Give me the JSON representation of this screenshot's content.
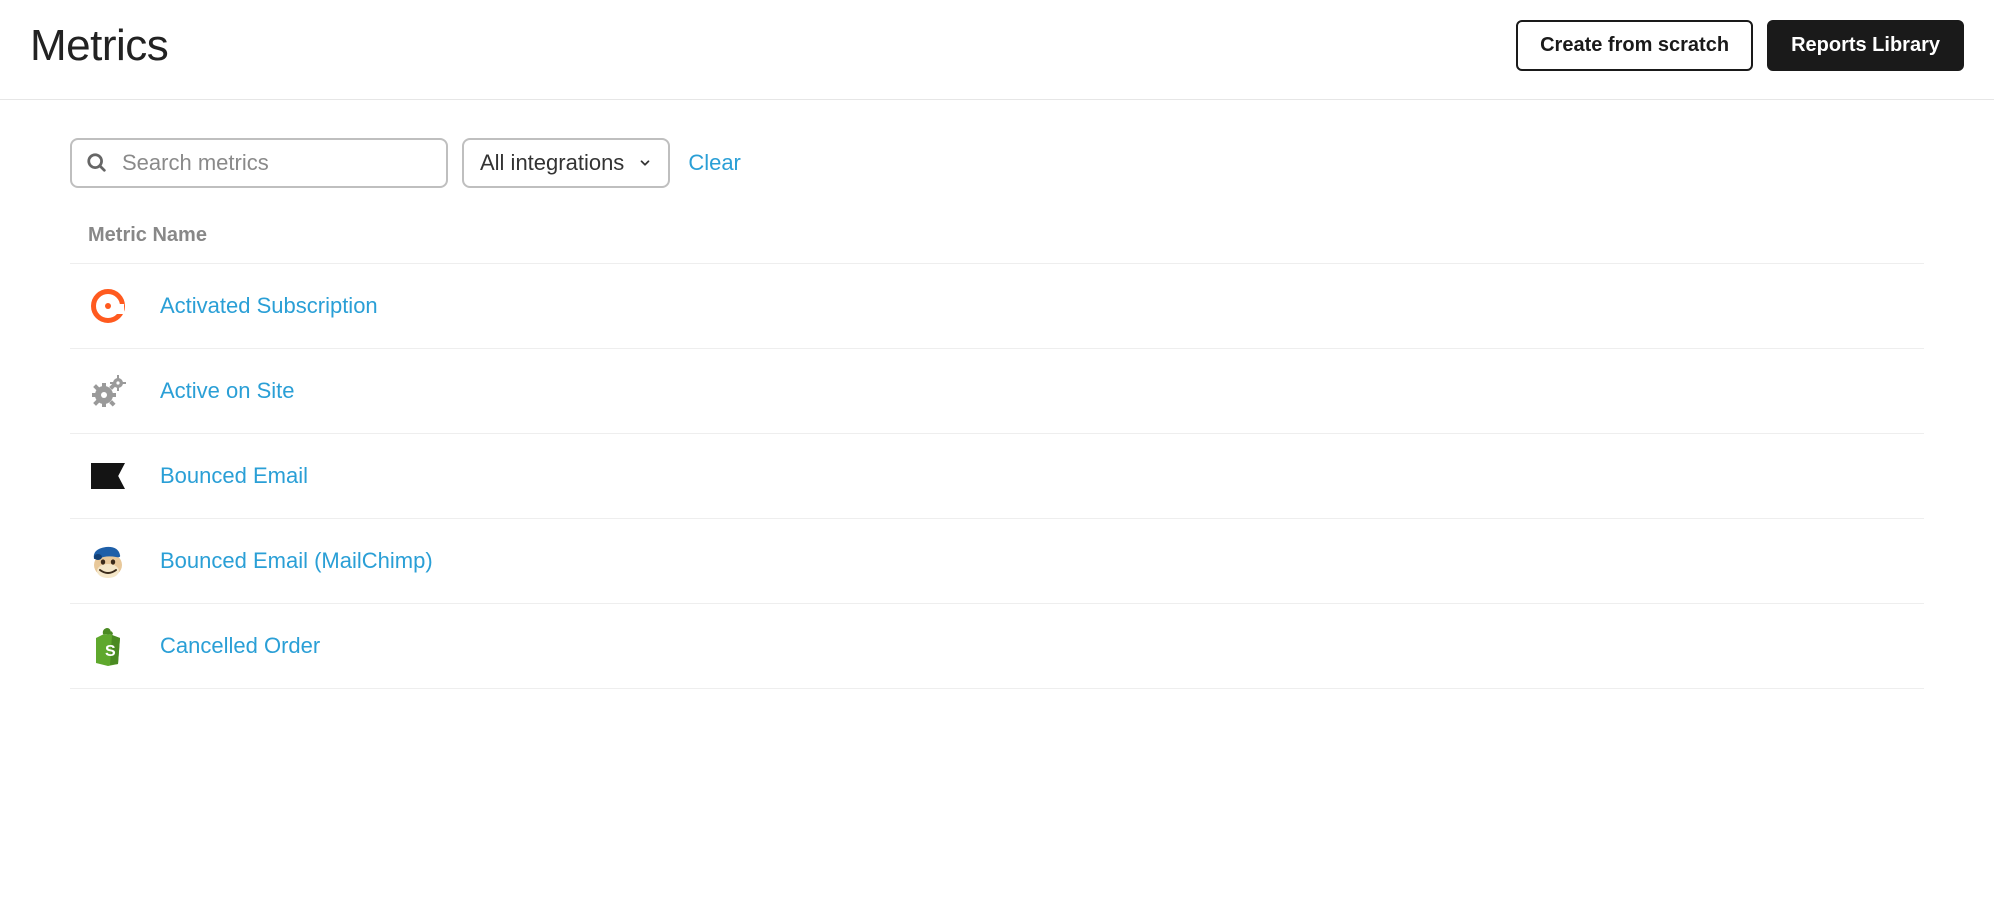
{
  "header": {
    "title": "Metrics",
    "create_label": "Create from scratch",
    "library_label": "Reports Library"
  },
  "filters": {
    "search_placeholder": "Search metrics",
    "integrations_label": "All integrations",
    "clear_label": "Clear"
  },
  "table": {
    "column_header": "Metric Name",
    "rows": [
      {
        "icon": "chargebee-icon",
        "label": "Activated Subscription"
      },
      {
        "icon": "gears-icon",
        "label": "Active on Site"
      },
      {
        "icon": "klaviyo-flag-icon",
        "label": "Bounced Email"
      },
      {
        "icon": "mailchimp-icon",
        "label": "Bounced Email (MailChimp)"
      },
      {
        "icon": "shopify-icon",
        "label": "Cancelled Order"
      }
    ]
  }
}
